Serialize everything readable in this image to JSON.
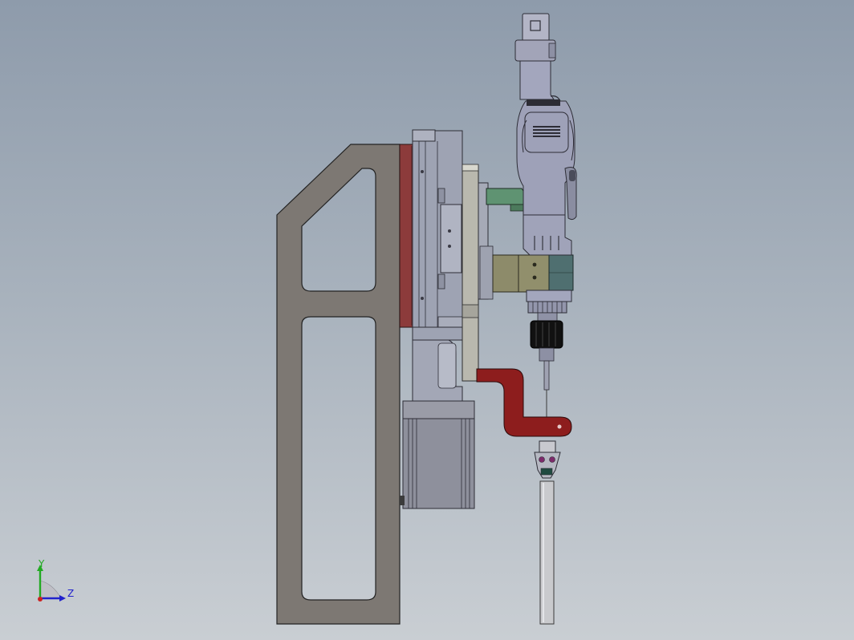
{
  "viewport": {
    "background_top": "#8e9bab",
    "background_bottom": "#c9ced3"
  },
  "model": {
    "frame_color": "#7d7873",
    "plate_red_color": "#8c3b3b",
    "slide_color": "#9ea3b3",
    "motor_color": "#8e909c",
    "bracket_olive_color": "#8d8b6a",
    "bracket_green_color": "#5f9372",
    "bracket_teal_color": "#4f6f70",
    "spindle_color": "#a3a6bd",
    "holder_red_color": "#8d1d1d",
    "chuck_black_color": "#111111",
    "tube_color": "#c9cacd"
  },
  "triad": {
    "y_label": "Y",
    "z_label": "Z",
    "y_color": "#22aa22",
    "z_color": "#2222cc",
    "x_color": "#cc2222"
  }
}
